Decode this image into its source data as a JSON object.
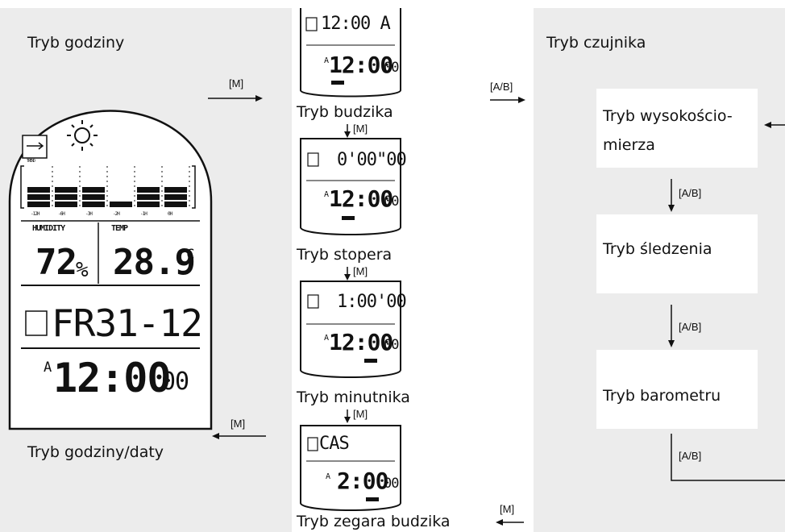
{
  "clock_panel": {
    "title": "Tryb godziny",
    "to_alarm_key": "[M]",
    "from_alarm_clock_key": "[M]",
    "caption": "Tryb godziny/daty"
  },
  "main_display": {
    "humidity_label": "HUMIDITY",
    "temp_label": "TEMP",
    "humidity_value": "72",
    "humidity_unit": "%",
    "temp_value": "28.9",
    "temp_unit": "°C",
    "date_value": "FR31-12",
    "am_marker": "A",
    "time_value": "12:00",
    "seconds_value": "00",
    "trend_label": "TREND",
    "bar_axis_labels": [
      "-12H",
      "-6H",
      "-3H",
      "-2H",
      "-1H",
      "0H"
    ],
    "bar_levels": [
      0.45,
      0.45,
      0.58,
      0.2,
      0.45,
      0.45
    ]
  },
  "mode_chain": {
    "alarm": {
      "top": "12:00 A",
      "time": "12:00",
      "seconds": "00",
      "am": "A",
      "caption": "Tryb budzika"
    },
    "stopwatch": {
      "top": "0'00\"00",
      "time": "12:00",
      "seconds": "00",
      "am": "A",
      "caption": "Tryb stopera"
    },
    "timer": {
      "top": "1:00'00",
      "time": "12:00",
      "seconds": "00",
      "am": "A",
      "caption": "Tryb minutnika"
    },
    "alarm_clock": {
      "top": "CAS",
      "time": "2:00",
      "seconds": "00",
      "am": "A",
      "caption": "Tryb zegara budzika"
    },
    "step_key": "[M]",
    "to_sensor_key": "[A/B]"
  },
  "sensor_panel": {
    "title": "Tryb czujnika",
    "altimeter": "Tryb wysokościo-\nmierza",
    "tracking": "Tryb śledzenia",
    "barometer": "Tryb barometru",
    "step_key": "[A/B]"
  }
}
